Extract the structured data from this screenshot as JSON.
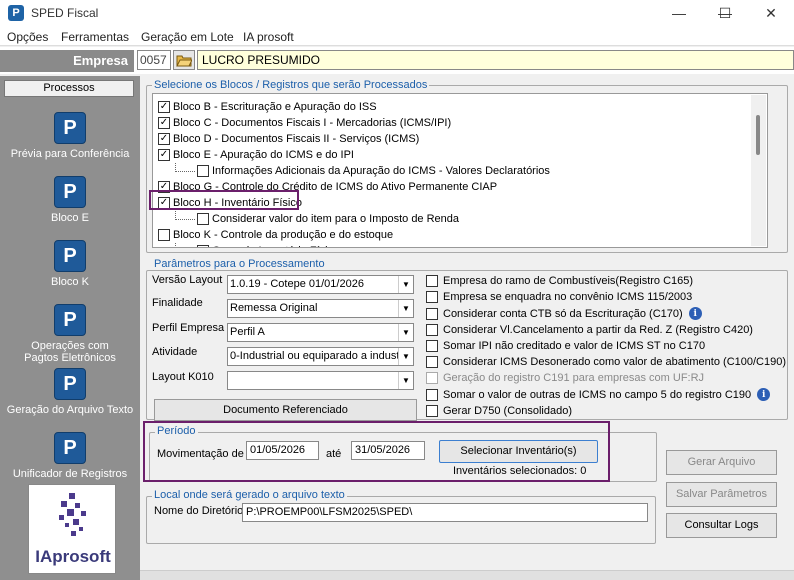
{
  "window": {
    "title": "SPED Fiscal",
    "app_icon": "P",
    "minimize": "—",
    "maximize": "☐",
    "close": "✕"
  },
  "menu": [
    "Opções",
    "Ferramentas",
    "Geração em Lote",
    "IA prosoft"
  ],
  "empresa": {
    "label": "Empresa",
    "code": "0057",
    "name": "LUCRO PRESUMIDO"
  },
  "sidebar": {
    "tab": "Processos",
    "items": [
      {
        "label": "Prévia para Conferência",
        "icon": "prosoft-p-icon"
      },
      {
        "label": "Bloco E",
        "icon": "prosoft-p-icon"
      },
      {
        "label": "Bloco K",
        "icon": "prosoft-p-icon"
      },
      {
        "label": "Operações com Pagtos Eletrônicos",
        "icon": "prosoft-p-icon"
      },
      {
        "label": "Geração do Arquivo Texto",
        "icon": "prosoft-p-icon"
      },
      {
        "label": "Unificador de Registros",
        "icon": "prosoft-p-icon"
      }
    ],
    "logo_text": "IAprosoft"
  },
  "blocks": {
    "title": "Selecione os Blocos / Registros que serão Processados",
    "items": [
      {
        "label": "Bloco B - Escrituração e Apuração do ISS",
        "checked": true,
        "indent": 0
      },
      {
        "label": "Bloco C - Documentos Fiscais I - Mercadorias (ICMS/IPI)",
        "checked": true,
        "indent": 0
      },
      {
        "label": "Bloco D - Documentos Fiscais II - Serviços (ICMS)",
        "checked": true,
        "indent": 0
      },
      {
        "label": "Bloco E - Apuração do ICMS e do IPI",
        "checked": true,
        "indent": 0
      },
      {
        "label": "Informações Adicionais da Apuração do ICMS - Valores Declaratórios",
        "checked": false,
        "indent": 1
      },
      {
        "label": "Bloco G - Controle do Crédito de ICMS do Ativo Permanente CIAP",
        "checked": true,
        "indent": 0
      },
      {
        "label": "Bloco H - Inventário Físico",
        "checked": true,
        "indent": 0
      },
      {
        "label": "Considerar valor do item para o Imposto de Renda",
        "checked": false,
        "indent": 1
      },
      {
        "label": "Bloco K - Controle da produção e do estoque",
        "checked": false,
        "indent": 0
      },
      {
        "label": "Gerar do Inventário Físico",
        "checked": false,
        "indent": 1
      }
    ]
  },
  "params": {
    "title": "Parâmetros para o Processamento",
    "versao_label": "Versão Layout",
    "versao_value": "1.0.19 - Cotepe 01/01/2026",
    "finalidade_label": "Finalidade",
    "finalidade_value": "Remessa Original",
    "perfil_label": "Perfil Empresa",
    "perfil_value": "Perfil A",
    "atividade_label": "Atividade",
    "atividade_value": "0-Industrial ou equiparado a indust",
    "layout_k010_label": "Layout K010",
    "layout_k010_value": "",
    "doc_ref_button": "Documento Referenciado",
    "options": [
      {
        "label": "Empresa do ramo de Combustíveis(Registro C165)",
        "checked": false,
        "disabled": false,
        "info": false
      },
      {
        "label": "Empresa se enquadra no convênio ICMS 115/2003",
        "checked": false,
        "disabled": false,
        "info": false
      },
      {
        "label": "Considerar conta CTB só da Escrituração (C170)",
        "checked": false,
        "disabled": false,
        "info": true
      },
      {
        "label": "Considerar Vl.Cancelamento a partir da Red. Z (Registro C420)",
        "checked": false,
        "disabled": false,
        "info": false
      },
      {
        "label": "Somar IPI não creditado e valor de ICMS ST no C170",
        "checked": false,
        "disabled": false,
        "info": false
      },
      {
        "label": "Considerar ICMS Desonerado como valor de abatimento (C100/C190)",
        "checked": false,
        "disabled": false,
        "info": false
      },
      {
        "label": "Geração do registro C191 para empresas com UF:RJ",
        "checked": false,
        "disabled": true,
        "info": false
      },
      {
        "label": "Somar o valor de outras de ICMS no campo 5 do registro C190",
        "checked": false,
        "disabled": false,
        "info": true
      },
      {
        "label": "Gerar D750 (Consolidado)",
        "checked": false,
        "disabled": false,
        "info": false
      }
    ]
  },
  "periodo": {
    "title": "Período",
    "mov_label": "Movimentação de",
    "start": "01/05/2026",
    "ate_label": "até",
    "end": "31/05/2026",
    "select_button": "Selecionar Inventário(s)",
    "selected_text": "Inventários selecionados: 0"
  },
  "local": {
    "title": "Local onde será gerado o arquivo texto",
    "dir_label": "Nome do Diretório",
    "dir_value": "P:\\PROEMP00\\LFSM2025\\SPED\\"
  },
  "actions": {
    "gerar": "Gerar Arquivo",
    "salvar": "Salvar Parâmetros",
    "logs": "Consultar Logs"
  }
}
